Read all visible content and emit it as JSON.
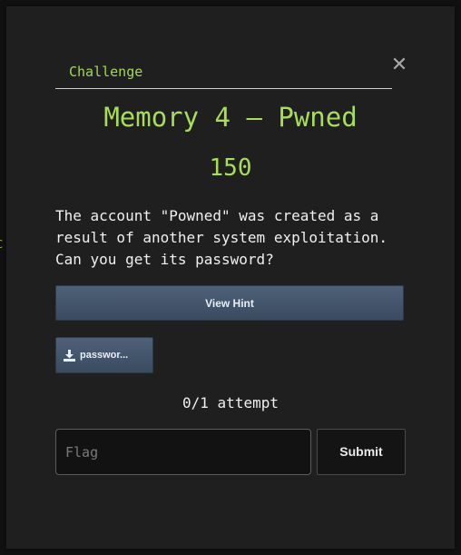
{
  "background": {
    "partial_text": "C"
  },
  "modal": {
    "tab_label": "Challenge",
    "close_symbol": "✕",
    "title": "Memory 4 – Pwned",
    "points": "150",
    "description": "The account \"Powned\" was created as a result of another system exploitation. Can you get its password?",
    "hint_button": "View Hint",
    "file_button": "passwor...",
    "attempts": "0/1 attempt",
    "flag_placeholder": "Flag",
    "flag_value": "",
    "submit_button": "Submit"
  },
  "colors": {
    "accent": "#a6df55",
    "button": "#4e6178",
    "modal_bg": "#1f1f1f"
  },
  "icons": {
    "close": "close-icon",
    "download": "download-icon"
  }
}
